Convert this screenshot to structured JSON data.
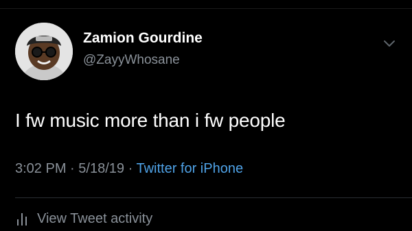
{
  "tweet": {
    "author_name": "Zamion Gourdine",
    "author_handle": "@ZayyWhosane",
    "text": "I fw music more than i fw people",
    "time": "3:02 PM",
    "separator": "·",
    "date": "5/18/19",
    "source": "Twitter for iPhone"
  },
  "actions": {
    "view_activity_label": "View Tweet activity"
  },
  "icons": {
    "menu": "chevron-down-icon",
    "activity": "bar-chart-icon"
  },
  "colors": {
    "background": "#000000",
    "text_primary": "#ffffff",
    "text_secondary": "#8a9199",
    "link": "#4fa3e8"
  }
}
